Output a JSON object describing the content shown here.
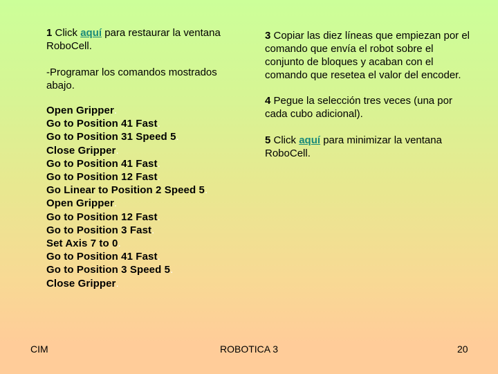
{
  "colors": {
    "background_top": "#ccff99",
    "background_middle": "#e8e890",
    "background_bottom": "#ffcc99",
    "link": "#1a8a7a",
    "text": "#000000"
  },
  "left_column": {
    "step1": {
      "number": "1",
      "before_link": " Click ",
      "link_text": "aquí",
      "after_link": " para restaurar la ventana RoboCell."
    },
    "instruction": "-Programar los comandos mostrados abajo."
  },
  "commands": [
    "Open Gripper",
    "Go to Position 41 Fast",
    "Go to Position 31 Speed 5",
    "Close Gripper",
    "Go to Position 41 Fast",
    "Go to Position 12 Fast",
    "Go Linear to Position 2 Speed 5",
    "Open Gripper",
    "Go to Position 12 Fast",
    "Go to Position 3 Fast",
    "Set Axis 7 to 0",
    "Go to Position 41 Fast",
    "Go to Position 3 Speed 5",
    "Close Gripper"
  ],
  "command_terminator": ".",
  "right_column": {
    "step3": {
      "number": "3",
      "text": " Copiar las diez líneas que empiezan por el comando que envía el robot sobre el conjunto de bloques y acaban con el comando que resetea el valor del encoder."
    },
    "step4": {
      "number": "4",
      "text": " Pegue la selección tres veces (una por cada cubo adicional)."
    },
    "step5": {
      "number": "5",
      "before_link": " Click ",
      "link_text": "aquí",
      "after_link": " para minimizar la ventana RoboCell."
    }
  },
  "footer": {
    "left": "CIM",
    "center": "ROBOTICA 3",
    "page_number": "20"
  }
}
